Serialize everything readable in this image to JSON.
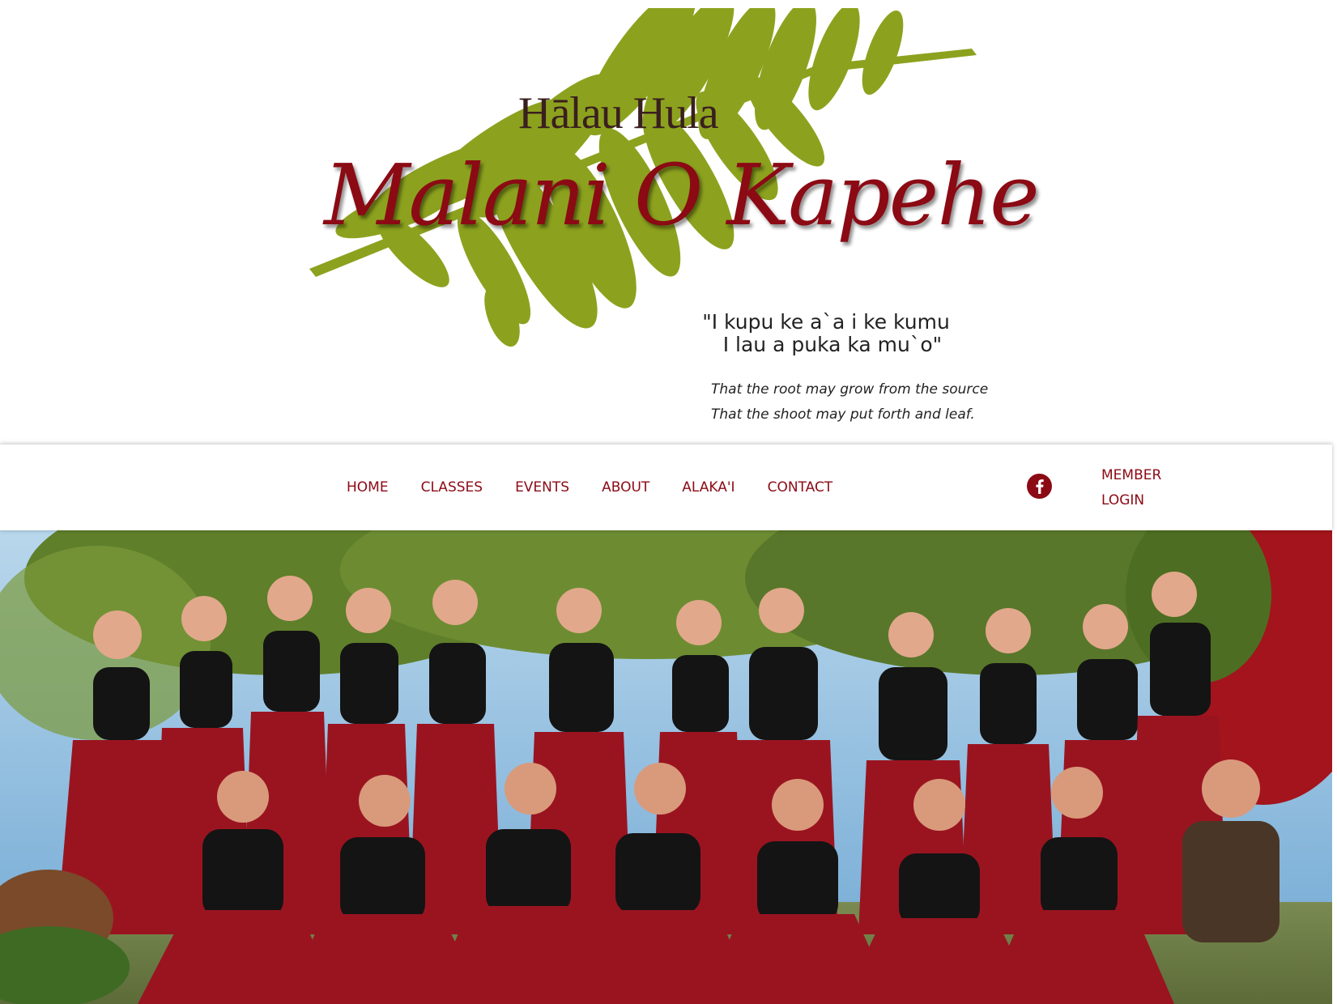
{
  "header": {
    "subtitle": "Hālau Hula",
    "title": "Malani O Kapehe",
    "motto": {
      "line1": "\"I kupu ke a`a i ke kumu",
      "line2": "  I lau a puka ka mu`o\""
    },
    "translation": {
      "line1": "That the root may grow from the source",
      "line2": "That the shoot may put forth and leaf."
    }
  },
  "nav": {
    "items": [
      {
        "label": "HOME"
      },
      {
        "label": "CLASSES"
      },
      {
        "label": "EVENTS"
      },
      {
        "label": "ABOUT"
      },
      {
        "label": "ALAKA'I"
      },
      {
        "label": "CONTACT"
      }
    ],
    "social_icon": "facebook-icon",
    "login": {
      "line1": "MEMBER",
      "line2": "LOGIN"
    }
  },
  "colors": {
    "brand_red": "#8b0a14",
    "fern_green": "#8ca21e",
    "skirt_red": "#9a1420",
    "top_black": "#141414"
  }
}
